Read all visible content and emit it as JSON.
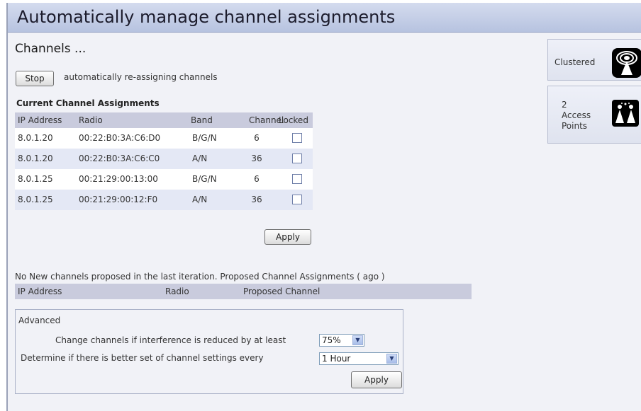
{
  "header": {
    "title": "Automatically manage channel assignments"
  },
  "channels": {
    "title": "Channels ...",
    "stop_label": "Stop",
    "status_text": "automatically re-assigning channels"
  },
  "current": {
    "title": "Current Channel Assignments",
    "columns": [
      "IP Address",
      "Radio",
      "Band",
      "Channel",
      "Locked"
    ],
    "rows": [
      {
        "ip": "8.0.1.20",
        "radio": "00:22:B0:3A:C6:D0",
        "band": "B/G/N",
        "channel": "6",
        "locked": false
      },
      {
        "ip": "8.0.1.20",
        "radio": "00:22:B0:3A:C6:C0",
        "band": "A/N",
        "channel": "36",
        "locked": false
      },
      {
        "ip": "8.0.1.25",
        "radio": "00:21:29:00:13:00",
        "band": "B/G/N",
        "channel": "6",
        "locked": false
      },
      {
        "ip": "8.0.1.25",
        "radio": "00:21:29:00:12:F0",
        "band": "A/N",
        "channel": "36",
        "locked": false
      }
    ],
    "apply_label": "Apply"
  },
  "proposed": {
    "text": "No New channels proposed in the last iteration. Proposed Channel Assignments ( ago )",
    "columns": [
      "IP Address",
      "Radio",
      "Proposed Channel"
    ]
  },
  "advanced": {
    "title": "Advanced",
    "interference_label": "Change channels if interference is reduced by at least",
    "interference_value": "75%",
    "interval_label": "Determine if there is better set of channel settings every",
    "interval_value": "1 Hour",
    "apply_label": "Apply"
  },
  "sidebar": {
    "clustered_label": "Clustered",
    "clustered_icon": "cluster-signal-icon",
    "ap_count": "2",
    "ap_label_line1": "Access",
    "ap_label_line2": "Points",
    "ap_icon": "access-points-icon"
  },
  "colors": {
    "header_bg": "#c3cde6",
    "table_header_bg": "#c9cbdd",
    "row_alt_bg": "#e4e8f5",
    "page_bg": "#f1f2f7"
  }
}
